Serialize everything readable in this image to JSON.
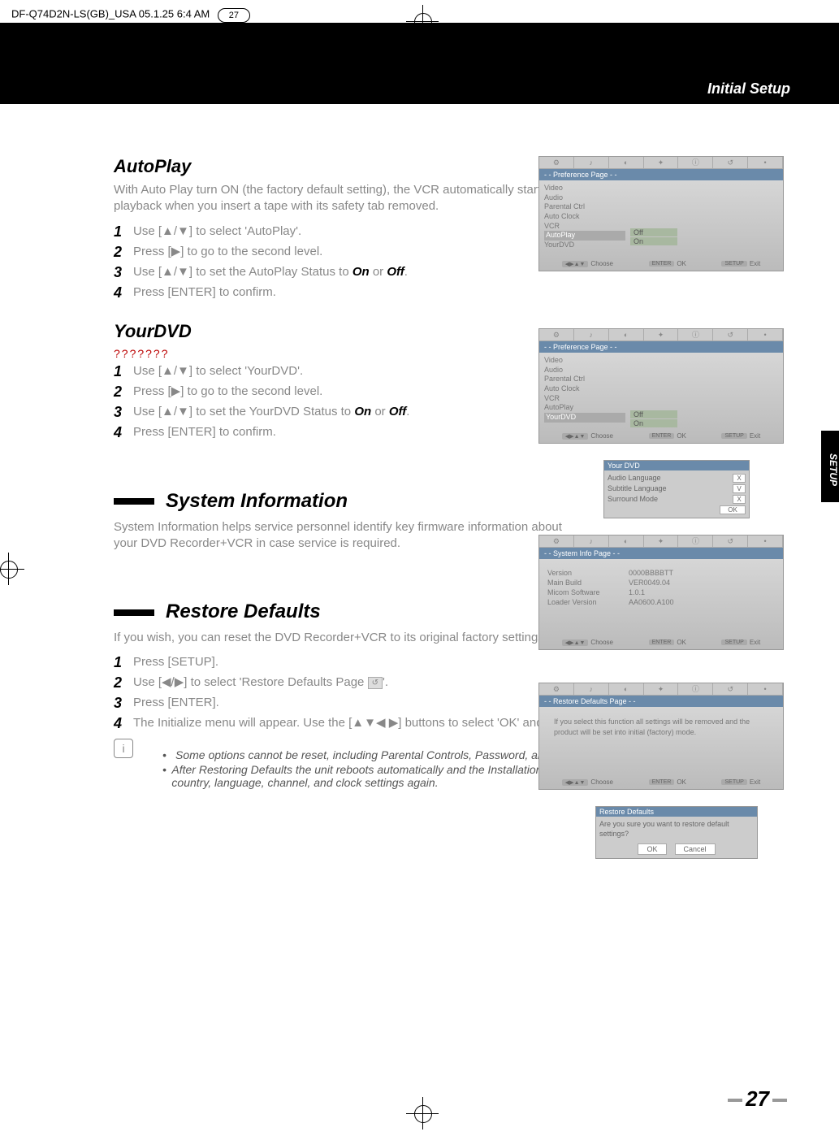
{
  "header": {
    "filename": "DF-Q74D2N-LS(GB)_USA  05.1.25 6:4 AM",
    "pagehint": "27"
  },
  "band": {
    "section": "Initial Setup"
  },
  "sidetab": "SETUP",
  "autoplay": {
    "title": "AutoPlay",
    "intro": "With Auto Play turn ON (the factory default setting), the VCR automatically starts playback when you insert a tape with its safety tab removed.",
    "s1": "Use [▲/▼] to select 'AutoPlay'.",
    "s2": "Press [▶] to go to the second level.",
    "s3a": "Use [▲/▼] to set the AutoPlay Status to ",
    "s3b": "On",
    "s3c": " or ",
    "s3d": "Off",
    "s3e": ".",
    "s4": "Press [ENTER] to confirm."
  },
  "yourdvd": {
    "title": "YourDVD",
    "sub": "???????",
    "s1": "Use [▲/▼] to select 'YourDVD'.",
    "s2": "Press [▶] to go to the second level.",
    "s3a": "Use [▲/▼] to set the YourDVD Status to ",
    "s3b": "On",
    "s3c": " or ",
    "s3d": "Off",
    "s3e": ".",
    "s4": "Press [ENTER] to confirm."
  },
  "sysinfo": {
    "title": "System Information",
    "intro": "System Information helps service personnel identify key firmware information about your DVD Recorder+VCR in case service is required."
  },
  "restore": {
    "title": "Restore Defaults",
    "intro": "If you wish, you can reset the DVD Recorder+VCR to its original factory settings.",
    "s1": "Press [SETUP].",
    "s2a": "Use [◀/▶] to select 'Restore Defaults Page ",
    "s2b": "'.",
    "s3": "Press [ENTER].",
    "s4": "The Initialize menu will appear. Use the [▲▼◀ ▶] buttons to select 'OK' and press [ENTER].",
    "note1": "Some options cannot be reset, including Parental Controls, Password, and Country Code.",
    "note2": "After Restoring Defaults the unit reboots automatically and the Installation menu appears.  You must set the country, language, channel, and clock settings again."
  },
  "osd": {
    "prefpage": "- - Preference Page - -",
    "items": [
      "Video",
      "Audio",
      "Parental Ctrl",
      "Auto Clock",
      "VCR",
      "AutoPlay",
      "YourDVD"
    ],
    "opts": [
      "Off",
      "On"
    ],
    "choose": "Choose",
    "ok": "OK",
    "exit": "Exit",
    "enter": "ENTER",
    "setup": "SETUP"
  },
  "yourpop": {
    "title": "Your DVD",
    "r1": "Audio Language",
    "r1v": "X",
    "r2": "Subtitle Language",
    "r2v": "V",
    "r3": "Surround Mode",
    "r3v": "X",
    "ok": "OK"
  },
  "info": {
    "title": "- - System Info Page - -",
    "r1l": "Version",
    "r1v": "0000BBBBTT",
    "r2l": "Main Build",
    "r2v": "VER0049.04",
    "r3l": "Micom Software",
    "r3v": "1.0.1",
    "r4l": "Loader Version",
    "r4v": "AA0600.A100"
  },
  "rest": {
    "title": "- - Restore Defaults Page - -",
    "body": "If you select this function all settings will be removed and the product will be set into initial (factory) mode.",
    "poptitle": "Restore Defaults",
    "popbody": "Are you sure you want to restore default settings?",
    "ok": "OK",
    "cancel": "Cancel"
  },
  "pagenum": "27"
}
